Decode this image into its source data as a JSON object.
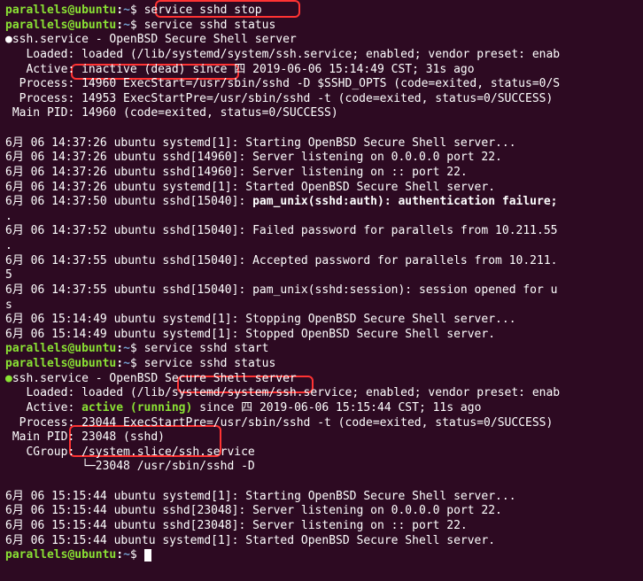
{
  "prompt": {
    "user": "parallels",
    "at": "@",
    "host": "ubuntu",
    "colon": ":",
    "path": "~",
    "dollar": "$"
  },
  "lines": {
    "c1": "service sshd stop",
    "c2": "service sshd status",
    "svc1": "ssh.service - OpenBSD Secure Shell server",
    "loaded1": "   Loaded: loaded (/lib/systemd/system/ssh.service; enabled; vendor preset: enab",
    "active1a": "   Active: ",
    "active1b": "inactive (dead)",
    "active1c": " since 四 2019-06-06 15:14:49 CST; 31s ago",
    "proc1": "  Process: 14960 ExecStart=/usr/sbin/sshd -D $SSHD_OPTS (code=exited, status=0/S",
    "proc2": "  Process: 14953 ExecStartPre=/usr/sbin/sshd -t (code=exited, status=0/SUCCESS)",
    "mainpid1": " Main PID: 14960 (code=exited, status=0/SUCCESS)",
    "blank": "",
    "log1": "6月 06 14:37:26 ubuntu systemd[1]: Starting OpenBSD Secure Shell server...",
    "log2": "6月 06 14:37:26 ubuntu sshd[14960]: Server listening on 0.0.0.0 port 22.",
    "log3": "6月 06 14:37:26 ubuntu sshd[14960]: Server listening on :: port 22.",
    "log4": "6月 06 14:37:26 ubuntu systemd[1]: Started OpenBSD Secure Shell server.",
    "log5a": "6月 06 14:37:50 ubuntu sshd[15040]: ",
    "log5b": "pam_unix(sshd:auth): authentication failure;",
    "cont1": ".",
    "log6": "6月 06 14:37:52 ubuntu sshd[15040]: Failed password for parallels from 10.211.55",
    "cont2": ".",
    "log7": "6月 06 14:37:55 ubuntu sshd[15040]: Accepted password for parallels from 10.211.",
    "cont3": "5",
    "log8": "6月 06 14:37:55 ubuntu sshd[15040]: pam_unix(sshd:session): session opened for u",
    "cont4": "s",
    "log9": "6月 06 15:14:49 ubuntu systemd[1]: Stopping OpenBSD Secure Shell server...",
    "log10": "6月 06 15:14:49 ubuntu systemd[1]: Stopped OpenBSD Secure Shell server.",
    "c3": "service sshd start",
    "c4": "service sshd status",
    "svc2": "ssh.service - OpenBSD Secure Shell server",
    "loaded2": "   Loaded: loaded (/lib/systemd/system/ssh.service; enabled; vendor preset: enab",
    "active2a": "   Active: ",
    "active2b": "active (running)",
    "active2c": " since 四 2019-06-06 15:15:44 CST; 11s ago",
    "proc3": "  Process: 23044 ExecStartPre=/usr/sbin/sshd -t (code=exited, status=0/SUCCESS)",
    "mainpid2": " Main PID: 23048 (sshd)",
    "cgroup1": "   CGroup: /system.slice/ssh.service",
    "cgroup2": "           └─23048 /usr/sbin/sshd -D",
    "log11": "6月 06 15:15:44 ubuntu systemd[1]: Starting OpenBSD Secure Shell server...",
    "log12": "6月 06 15:15:44 ubuntu sshd[23048]: Server listening on 0.0.0.0 port 22.",
    "log13": "6月 06 15:15:44 ubuntu sshd[23048]: Server listening on :: port 22.",
    "log14": "6月 06 15:15:44 ubuntu systemd[1]: Started OpenBSD Secure Shell server."
  }
}
